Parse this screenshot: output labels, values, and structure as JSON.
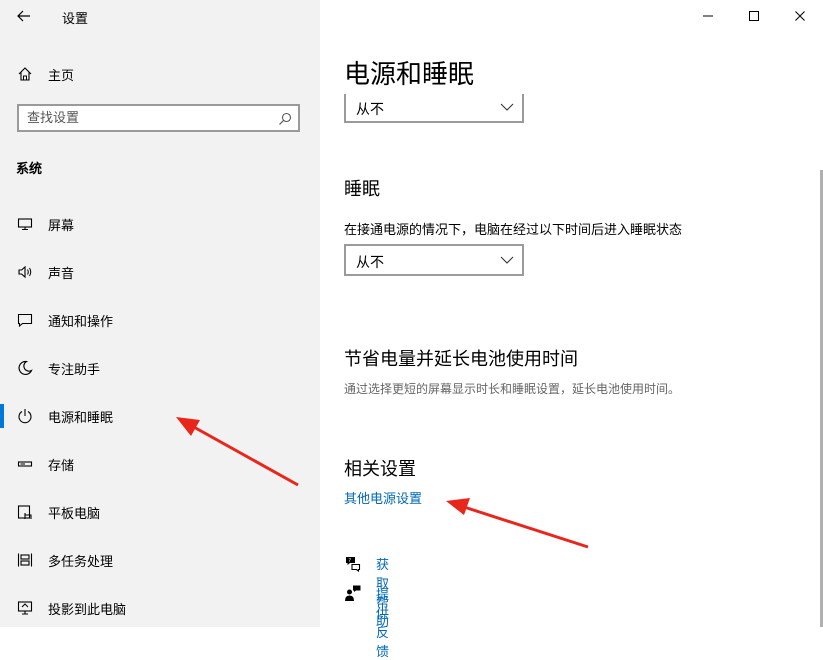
{
  "window": {
    "app_title": "设置",
    "accent": "#0078d7",
    "link_color": "#0067b8",
    "annotation_color": "#e8261c"
  },
  "sidebar": {
    "home_label": "主页",
    "search_placeholder": "查找设置",
    "section_title": "系统",
    "items": [
      {
        "label": "屏幕",
        "icon": "monitor-icon"
      },
      {
        "label": "声音",
        "icon": "speaker-icon"
      },
      {
        "label": "通知和操作",
        "icon": "notification-icon"
      },
      {
        "label": "专注助手",
        "icon": "moon-icon"
      },
      {
        "label": "电源和睡眠",
        "icon": "power-icon",
        "active": true
      },
      {
        "label": "存储",
        "icon": "storage-icon"
      },
      {
        "label": "平板电脑",
        "icon": "tablet-icon"
      },
      {
        "label": "多任务处理",
        "icon": "multitask-icon"
      },
      {
        "label": "投影到此电脑",
        "icon": "project-icon"
      }
    ]
  },
  "main": {
    "page_title": "电源和睡眠",
    "screen_dropdown_value": "从不",
    "sleep": {
      "title": "睡眠",
      "description": "在接通电源的情况下，电脑在经过以下时间后进入睡眠状态",
      "dropdown_value": "从不"
    },
    "battery": {
      "title": "节省电量并延长电池使用时间",
      "description": "通过选择更短的屏幕显示时长和睡眠设置，延长电池使用时间。"
    },
    "related": {
      "title": "相关设置",
      "link": "其他电源设置"
    },
    "help": {
      "get_help": "获取帮助",
      "feedback": "提供反馈"
    }
  }
}
